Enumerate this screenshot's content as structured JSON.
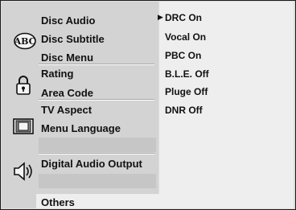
{
  "menu": {
    "groups": [
      {
        "icon": "abc-disc-icon",
        "items": [
          "Disc Audio",
          "Disc Subtitle",
          "Disc Menu"
        ]
      },
      {
        "icon": "padlock-icon",
        "items": [
          "Rating",
          "Area Code"
        ]
      },
      {
        "icon": "tv-screen-icon",
        "items": [
          "TV Aspect",
          "Menu Language"
        ]
      },
      {
        "icon": "speaker-icon",
        "items": [
          "Digital Audio Output"
        ]
      }
    ],
    "selected": "Others"
  },
  "settings": {
    "cursor": "▶",
    "items": [
      "DRC On",
      "Vocal On",
      "PBC On",
      "B.L.E. Off",
      "Pluge Off",
      "DNR Off"
    ]
  },
  "colors": {
    "background": "#d3d3d3",
    "panel": "#eeeeee",
    "text": "#111111"
  }
}
